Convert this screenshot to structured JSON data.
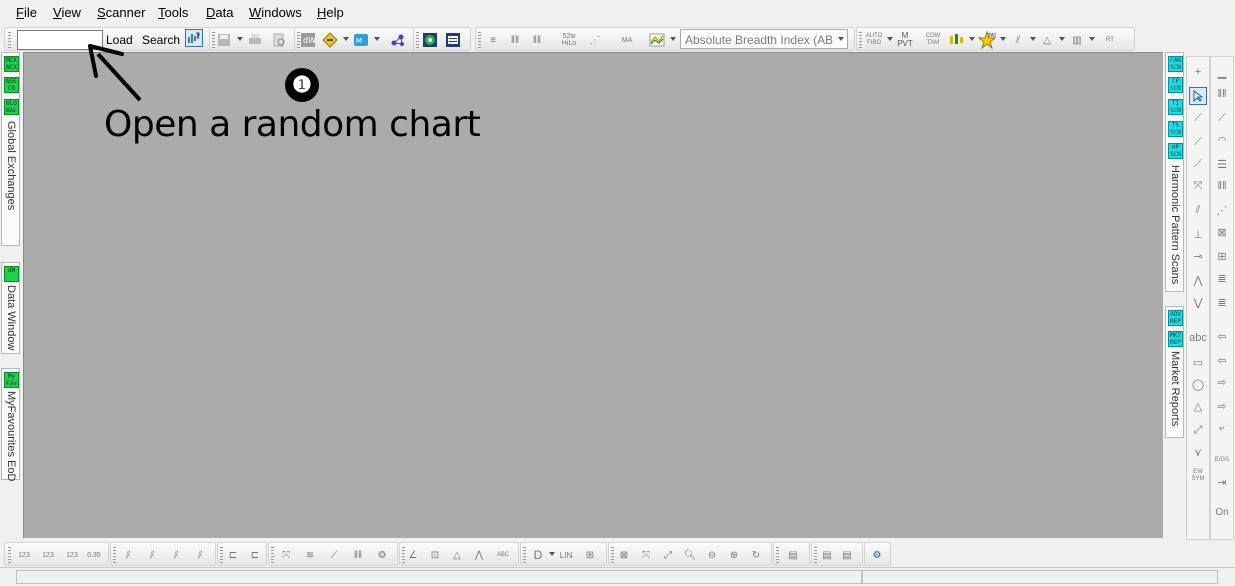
{
  "menu": {
    "file": {
      "first": "F",
      "rest": "ile"
    },
    "view": {
      "first": "V",
      "rest": "iew"
    },
    "scanner": {
      "first": "S",
      "rest": "canner"
    },
    "tools": {
      "first": "T",
      "rest": "ools"
    },
    "data": {
      "first": "D",
      "rest": "ata"
    },
    "windows": {
      "first": "W",
      "rest": "indows"
    },
    "help": {
      "first": "H",
      "rest": "elp"
    }
  },
  "toolbar": {
    "symbol_value": "",
    "load_label": "Load",
    "search_label": "Search",
    "indicator_selected": "Absolute Breadth Index (ABI",
    "labels": {
      "w52": "52w HiLo",
      "ma": "MA",
      "auto_fibo": "AUTO FIBO",
      "m_pvt": "M PVT",
      "cow_tam": "COW TAM",
      "tas": "TAS",
      "rt": "RT"
    }
  },
  "left_panel": {
    "buttons": [
      {
        "label": "MCX NCX",
        "kind": "green"
      },
      {
        "label": "NSE CD",
        "kind": "green"
      },
      {
        "label": "GLO BAL",
        "kind": "green"
      }
    ],
    "global_exchanges_label": "Global Exchanges",
    "data_window_btn": "dW",
    "data_window_label": "Data Window",
    "myfav_btn": "My Fav",
    "myfav_label": "MyFavourites EoD"
  },
  "right_panel": {
    "buttons": [
      {
        "label": "CAN SCN"
      },
      {
        "label": "CP SCN"
      },
      {
        "label": "TI SCN"
      },
      {
        "label": "TS SCN"
      },
      {
        "label": "HP SCN"
      }
    ],
    "harmonic_label": "Harmonic Pattern Scans",
    "report_buttons": [
      {
        "label": "ADV REP"
      },
      {
        "label": "MKT REP"
      }
    ],
    "market_reports_label": "Market Reports"
  },
  "draw_tools": {
    "text_tool": "abc",
    "ew_sym": "EW SYM",
    "on_label": "On",
    "col2_misc": "E/GS"
  },
  "bottom_toolbar": {
    "labels": {
      "n123a": "123",
      "n123b": "123",
      "n123c": "123",
      "n035": "0.35",
      "abc": "ABC",
      "lin": "LIN"
    }
  },
  "annotation": {
    "badge": "❶",
    "text": "Open a random chart"
  },
  "colors": {
    "workspace": "#ababab",
    "scanner_green": "#19d44b",
    "scanner_cyan": "#16e0e6",
    "chrome": "#f0f0f0"
  }
}
